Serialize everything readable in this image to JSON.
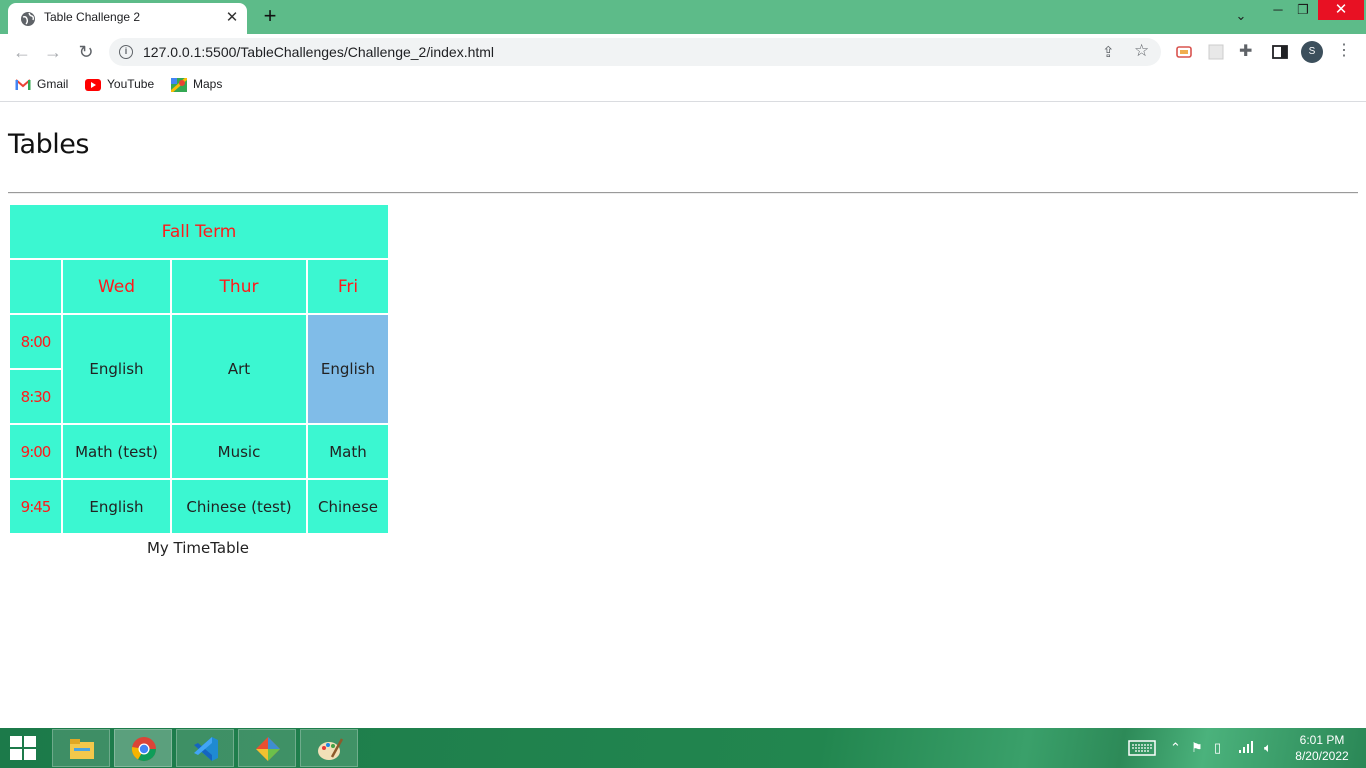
{
  "browser": {
    "tab": {
      "title": "Table Challenge 2"
    },
    "url": "127.0.0.1:5500/TableChallenges/Challenge_2/index.html",
    "avatar_letter": "S",
    "bookmarks": [
      {
        "label": "Gmail",
        "icon": "gmail-icon"
      },
      {
        "label": "YouTube",
        "icon": "youtube-icon"
      },
      {
        "label": "Maps",
        "icon": "maps-icon"
      }
    ]
  },
  "page": {
    "title": "Tables",
    "table": {
      "term": "Fall Term",
      "days": [
        "Wed",
        "Thur",
        "Fri"
      ],
      "times": [
        "8:00",
        "8:30",
        "9:00",
        "9:45"
      ],
      "rows": {
        "r1": [
          "English",
          "Art",
          "English"
        ],
        "r2": [
          "Math (test)",
          "Music",
          "Math"
        ],
        "r3": [
          "English",
          "Chinese (test)",
          "Chinese"
        ]
      },
      "caption": "My TimeTable"
    }
  },
  "colors": {
    "cell_bg": "#3bf7d1",
    "highlight_cell": "#80bce8",
    "header_text": "#ff1a1a",
    "tabstrip": "#5dbb89"
  },
  "taskbar": {
    "apps": [
      "file-explorer",
      "chrome",
      "vscode",
      "git-app",
      "paint"
    ],
    "clock": {
      "time": "6:01 PM",
      "date": "8/20/2022"
    }
  }
}
